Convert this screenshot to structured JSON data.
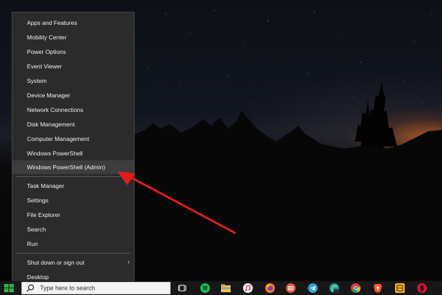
{
  "menu": {
    "items": [
      {
        "label": "Apps and Features"
      },
      {
        "label": "Mobility Center"
      },
      {
        "label": "Power Options"
      },
      {
        "label": "Event Viewer"
      },
      {
        "label": "System"
      },
      {
        "label": "Device Manager"
      },
      {
        "label": "Network Connections"
      },
      {
        "label": "Disk Management"
      },
      {
        "label": "Computer Management"
      },
      {
        "label": "Windows PowerShell"
      },
      {
        "label": "Windows PowerShell (Admin)",
        "highlighted": true
      },
      {
        "label": "Task Manager"
      },
      {
        "label": "Settings"
      },
      {
        "label": "File Explorer"
      },
      {
        "label": "Search"
      },
      {
        "label": "Run"
      },
      {
        "label": "Shut down or sign out",
        "submenu": true
      },
      {
        "label": "Desktop"
      }
    ]
  },
  "taskbar": {
    "search_placeholder": "Type here to search",
    "icons": [
      "task-view-icon",
      "spotify-icon",
      "file-explorer-icon",
      "itunes-icon",
      "firefox-icon",
      "app-icon",
      "telegram-icon",
      "edge-dev-icon",
      "chrome-icon",
      "brave-icon",
      "app-icon",
      "opera-icon"
    ]
  },
  "annotation": {
    "arrow_color": "#e21b1b"
  }
}
